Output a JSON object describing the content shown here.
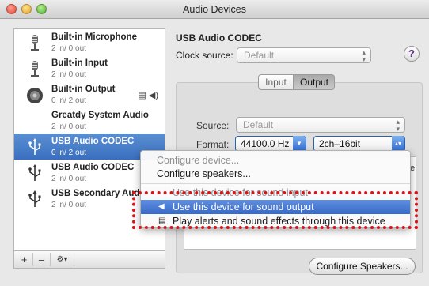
{
  "window": {
    "title": "Audio Devices"
  },
  "devices": [
    {
      "name": "Built-in Microphone",
      "channels": "2 in/ 0 out",
      "icon": "microphone-icon"
    },
    {
      "name": "Built-in Input",
      "channels": "2 in/ 0 out",
      "icon": "microphone-icon"
    },
    {
      "name": "Built-in Output",
      "channels": "0 in/ 2 out",
      "icon": "speaker-icon",
      "badges": "▤ ◀)"
    },
    {
      "name": "Greatdy System Audio",
      "channels": "2 in/ 0 out",
      "icon": "none"
    },
    {
      "name": "USB Audio CODEC",
      "channels": "0 in/ 2 out",
      "icon": "usb-icon",
      "selected": true
    },
    {
      "name": "USB Audio CODEC",
      "channels": "2 in/ 0 out",
      "icon": "usb-icon"
    },
    {
      "name": "USB Secondary Audio",
      "channels": "2 in/ 0 out",
      "icon": "usb-icon"
    }
  ],
  "sidebar_toolbar": {
    "add": "+",
    "remove": "–",
    "gear": "⚙▾"
  },
  "detail": {
    "device_title": "USB Audio CODEC",
    "clock_source_label": "Clock source:",
    "clock_source_value": "Default",
    "help": "?",
    "tabs": [
      "Input",
      "Output"
    ],
    "active_tab": "Output",
    "source_label": "Source:",
    "source_value": "Default",
    "format_label": "Format:",
    "format_rate": "44100.0 Hz",
    "format_bits": "2ch–16bit",
    "partial_column": "e",
    "configure_button": "Configure Speakers..."
  },
  "context_menu": {
    "items": [
      {
        "label": "Configure device...",
        "disabled": true
      },
      {
        "label": "Configure speakers...",
        "disabled": false
      },
      {
        "label": "Use this device for sound input",
        "disabled": true
      },
      {
        "label": "Use this device for sound output",
        "highlighted": true,
        "mark": "◀"
      },
      {
        "label": "Play alerts and sound effects through this device",
        "mark": "▤"
      }
    ]
  },
  "colors": {
    "selection": "#3a6fbf",
    "highlight_box": "#d5151a",
    "menu_highlight": "#3a69c6"
  }
}
